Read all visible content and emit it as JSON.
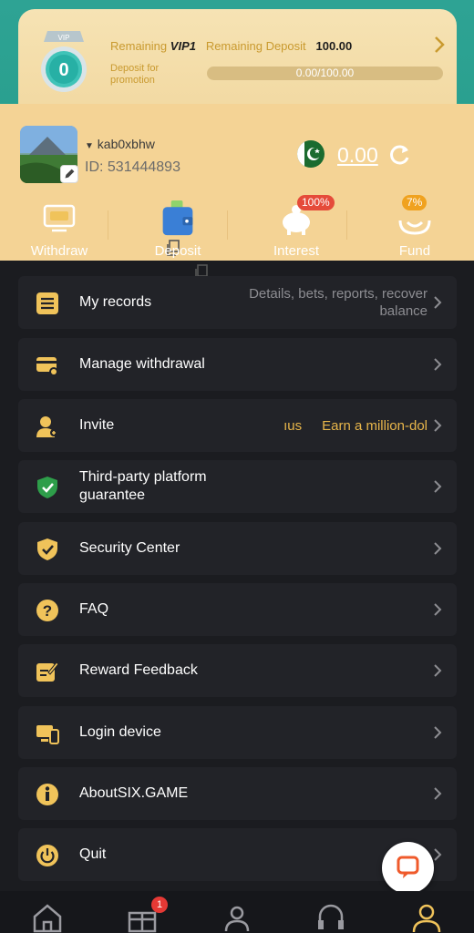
{
  "vip": {
    "badge_label": "VIP",
    "level": "0",
    "remaining_label": "Remaining",
    "vip_next": "VIP1",
    "remaining_deposit_label": "Remaining Deposit",
    "remaining_deposit_value": "100.00",
    "deposit_hint": "Deposit for promotion",
    "progress_text": "0.00/100.00",
    "progress_fraction": 0.0
  },
  "profile": {
    "username": "kab0xbhw",
    "id_text": "ID: 531444893",
    "balance": "0.00",
    "currency_flag": "pakistan-flag"
  },
  "quick_actions": [
    {
      "label": "Withdraw",
      "icon": "withdraw-icon"
    },
    {
      "label": "Deposit",
      "icon": "wallet-icon"
    },
    {
      "label": "Interest",
      "icon": "piggy-bank-icon",
      "badge": "100%"
    },
    {
      "label": "Fund",
      "icon": "fund-icon",
      "badge": "7%"
    }
  ],
  "menu": [
    {
      "label": "My records",
      "hint": "Details, bets, reports, recover balance",
      "icon": "records-icon"
    },
    {
      "label": "Manage withdrawal",
      "hint": "",
      "icon": "card-settings-icon"
    },
    {
      "label": "Invite",
      "hint": "Earn a million-dol",
      "hint_prefix": "ıus",
      "icon": "invite-user-icon"
    },
    {
      "label": "Third-party platform guarantee",
      "hint": "",
      "icon": "shield-check-icon"
    },
    {
      "label": "Security Center",
      "hint": "",
      "icon": "security-shield-icon"
    },
    {
      "label": "FAQ",
      "hint": "",
      "icon": "question-icon"
    },
    {
      "label": "Reward Feedback",
      "hint": "",
      "icon": "feedback-edit-icon"
    },
    {
      "label": "Login device",
      "hint": "",
      "icon": "devices-icon"
    },
    {
      "label": "AboutSIX.GAME",
      "hint": "",
      "icon": "info-icon"
    },
    {
      "label": "Quit",
      "hint": "",
      "icon": "power-icon"
    }
  ],
  "bottom_nav": [
    {
      "name": "home",
      "icon": "home-icon"
    },
    {
      "name": "gifts",
      "icon": "gift-icon",
      "badge": "1"
    },
    {
      "name": "community",
      "icon": "users-icon"
    },
    {
      "name": "support",
      "icon": "headset-icon"
    },
    {
      "name": "profile",
      "icon": "user-icon"
    }
  ],
  "colors": {
    "accent_gold": "#c99a2f",
    "profile_bg": "#f4d395",
    "menu_bg": "#222328",
    "page_bg": "#1b1c20",
    "teal": "#2ea394"
  }
}
